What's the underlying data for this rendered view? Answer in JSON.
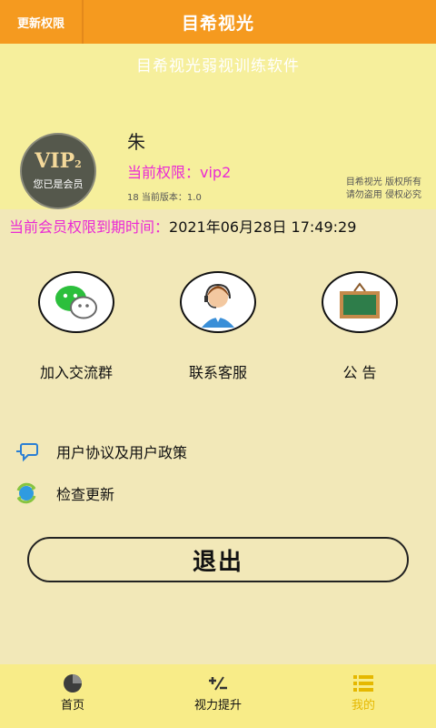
{
  "topbar": {
    "left_button": "更新权限",
    "title": "目希视光"
  },
  "profile": {
    "subtitle": "目希视光弱视训练软件",
    "avatar_vip": "VIP",
    "avatar_vip_level": "2",
    "avatar_member": "您已是会员",
    "name": "朱",
    "permission": "当前权限：vip2",
    "version_line": "18  当前版本：1.0",
    "rights_line1": "目希视光  版权所有",
    "rights_line2": "请勿盗用  侵权必究"
  },
  "expiry": {
    "label": "当前会员权限到期时间：",
    "value": "2021年06月28日 17:49:29"
  },
  "features": [
    {
      "label": "加入交流群",
      "icon": "wechat-icon"
    },
    {
      "label": "联系客服",
      "icon": "customer-service-icon"
    },
    {
      "label": "公  告",
      "icon": "blackboard-icon"
    }
  ],
  "list": [
    {
      "label": "用户协议及用户政策",
      "icon": "chat-bubble-icon"
    },
    {
      "label": "检查更新",
      "icon": "refresh-icon"
    }
  ],
  "logout": "退出",
  "tabs": [
    {
      "label": "首页",
      "icon": "pie-chart-icon"
    },
    {
      "label": "视力提升",
      "icon": "plus-minus-icon"
    },
    {
      "label": "我的",
      "icon": "list-icon",
      "active": true
    }
  ],
  "colors": {
    "topbar": "#f59a1f",
    "profile_bg": "#f6ef9c",
    "body_bg": "#f2e8b8",
    "accent_pink": "#ea2ad4",
    "tab_active": "#e5b800",
    "tabbar": "#f8ec88"
  }
}
